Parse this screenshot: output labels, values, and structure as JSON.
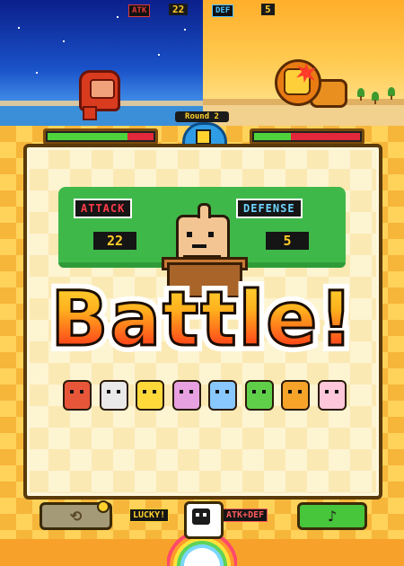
{
  "hud": {
    "atk_label": "ATK",
    "atk_value": "22",
    "def_label": "DEF",
    "def_value": "5"
  },
  "round": {
    "label": "Round 2"
  },
  "health": {
    "player_fraction": 0.75,
    "enemy_fraction": 0.35
  },
  "board": {
    "attack_label": "ATTACK",
    "attack_value": "22",
    "defense_label": "DEFENSE",
    "defense_value": "5"
  },
  "title": {
    "text": "Battle!"
  },
  "roster": [
    {
      "name": "red-monster",
      "color": "#e8563a"
    },
    {
      "name": "bug-eyed-robot",
      "color": "#e9e9e9"
    },
    {
      "name": "giraffe",
      "color": "#ffd93a"
    },
    {
      "name": "pink-hippo",
      "color": "#e7a0e0"
    },
    {
      "name": "blue-elephant",
      "color": "#88c8ff"
    },
    {
      "name": "green-frog",
      "color": "#5fcf4a"
    },
    {
      "name": "lion",
      "color": "#f6a32a"
    },
    {
      "name": "pink-rabbit",
      "color": "#ffc7d9"
    }
  ],
  "bottom": {
    "lucky_label": "LUCKY!",
    "atkdef_label": "ATK+DEF",
    "left_icon": "⟲",
    "right_icon": "♪"
  },
  "colors": {
    "attack": "#ff3b4a",
    "defense": "#6fd6ff",
    "board": "#3fb84a",
    "frame": "#f6b63a"
  }
}
